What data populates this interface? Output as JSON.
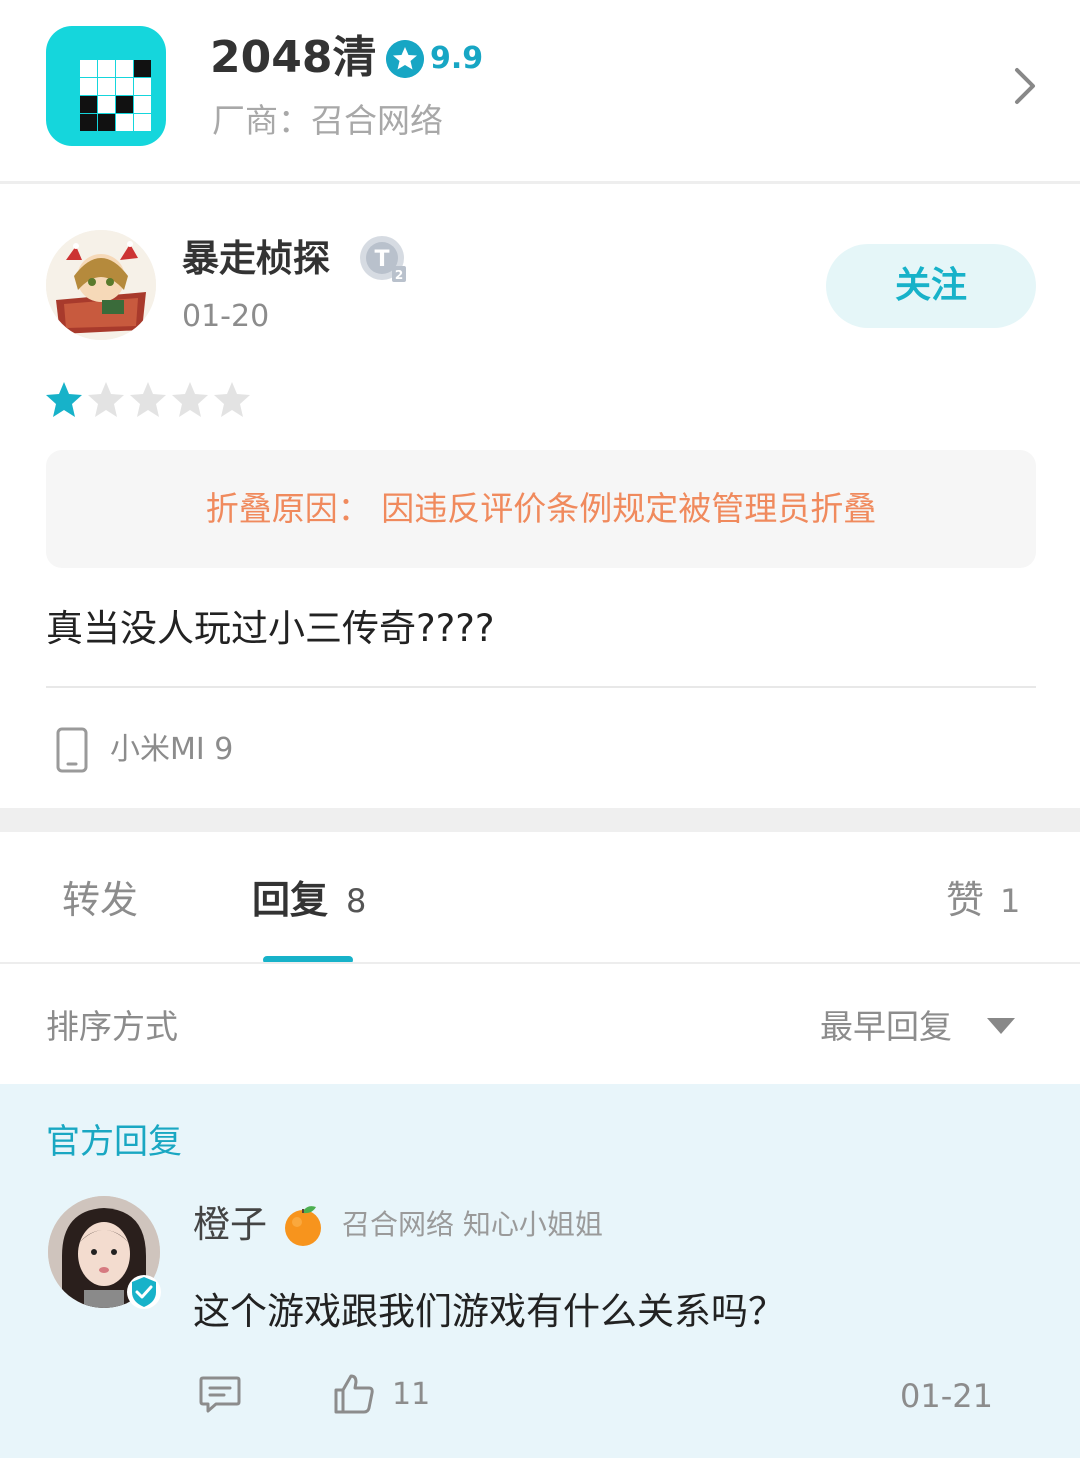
{
  "app": {
    "title": "2048清",
    "rating": "9.9",
    "vendor": "厂商：召合网络",
    "colors": {
      "icon_bg": "#15d6dc",
      "accent": "#17b2c9"
    }
  },
  "review": {
    "author": "暴走桢探",
    "date": "01-20",
    "follow_label": "关注",
    "stars_filled": 1,
    "stars_total": 5,
    "fold_notice": "折叠原因：  因违反评价条例规定被管理员折叠",
    "text": "真当没人玩过小三传奇????",
    "device": "小米MI 9"
  },
  "tabs": {
    "forward_label": "转发",
    "reply_label": "回复",
    "reply_count": "8",
    "like_label": "赞",
    "like_count": "1"
  },
  "sort": {
    "label": "排序方式",
    "value": "最早回复"
  },
  "official_reply": {
    "section_title": "官方回复",
    "name": "橙子",
    "role": "召合网络 知心小姐姐",
    "text": "这个游戏跟我们游戏有什么关系吗？",
    "like_count": "11",
    "date": "01-21"
  }
}
